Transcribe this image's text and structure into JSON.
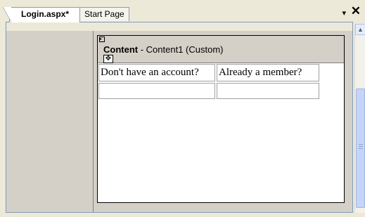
{
  "tabs": [
    {
      "label": "Login.aspx*",
      "active": true
    },
    {
      "label": "Start Page",
      "active": false
    }
  ],
  "content_control": {
    "name": "Content",
    "suffix": " - Content1 (Custom)"
  },
  "table": {
    "rows": [
      [
        "Don't have an account?",
        "Already a member?"
      ],
      [
        "",
        ""
      ]
    ]
  },
  "icons": {
    "tab_menu": "▾",
    "close": "✕",
    "scroll_up": "▲",
    "move": "✥",
    "smart_tag": "▸"
  }
}
